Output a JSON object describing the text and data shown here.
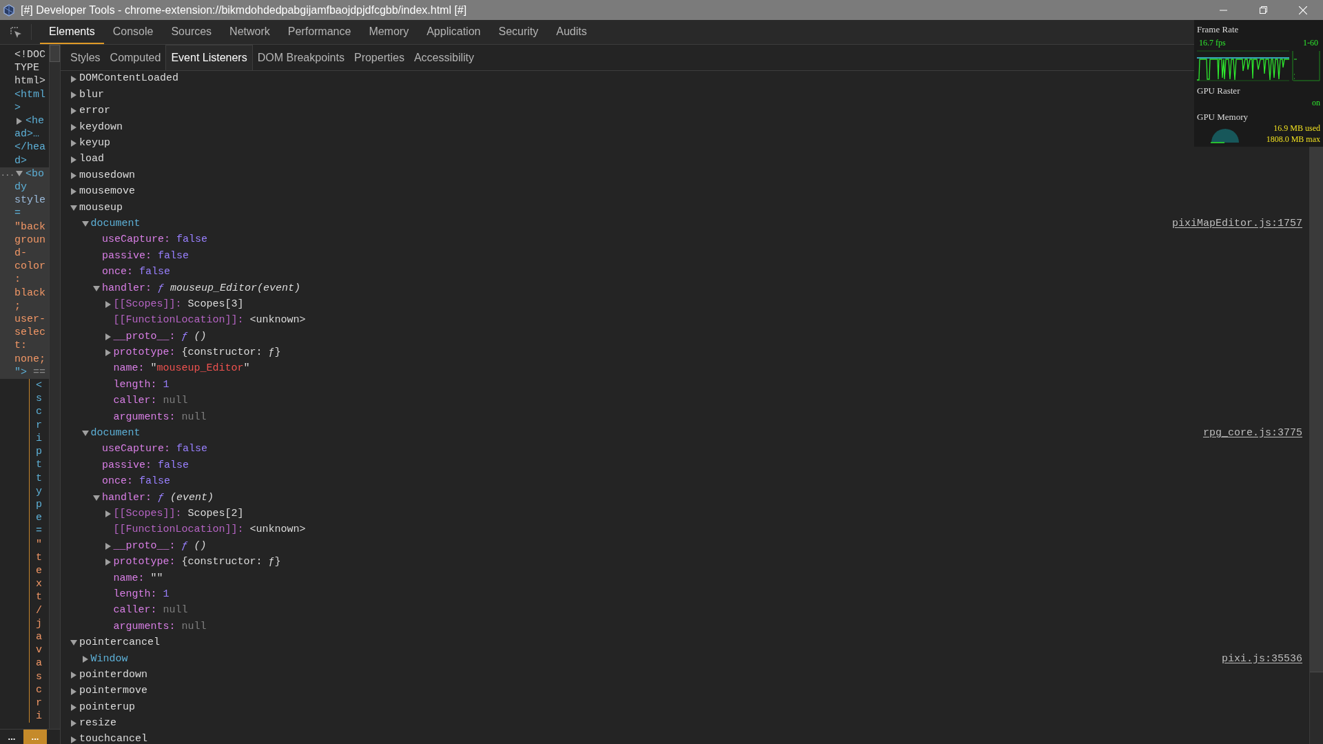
{
  "window": {
    "title": "[#] Developer Tools - chrome-extension://bikmdohdedpabgijamfbaojdpjdfcgbb/index.html [#]"
  },
  "tabs": [
    {
      "label": "Elements",
      "selected": true
    },
    {
      "label": "Console",
      "selected": false
    },
    {
      "label": "Sources",
      "selected": false
    },
    {
      "label": "Network",
      "selected": false
    },
    {
      "label": "Performance",
      "selected": false
    },
    {
      "label": "Memory",
      "selected": false
    },
    {
      "label": "Application",
      "selected": false
    },
    {
      "label": "Security",
      "selected": false
    },
    {
      "label": "Audits",
      "selected": false
    }
  ],
  "dom_panel": {
    "nodes": [
      {
        "kind": "block",
        "lines": [
          {
            "text": "<!DOC",
            "kind": "text"
          },
          {
            "text": "TYPE",
            "kind": "text"
          },
          {
            "text": "html>",
            "kind": "text"
          }
        ]
      },
      {
        "kind": "block",
        "lines": [
          {
            "text": "<html",
            "kind": "tag"
          },
          {
            "text": ">",
            "kind": "tag"
          }
        ]
      },
      {
        "kind": "block",
        "expanded": false,
        "selected": false,
        "lines": [
          {
            "text": "<he",
            "kind": "tag"
          },
          {
            "text": "ad>…",
            "kind": "tag"
          },
          {
            "text": "</hea",
            "kind": "tag"
          },
          {
            "text": "d>",
            "kind": "tag"
          }
        ]
      },
      {
        "kind": "block",
        "expanded": true,
        "selected": true,
        "more": "...",
        "marker": "==",
        "lines": [
          {
            "text": "<bo",
            "kind": "tag"
          },
          {
            "text": "dy",
            "kind": "tag"
          },
          {
            "text": "style",
            "kind": "attr"
          },
          {
            "text": "=",
            "kind": "tag"
          },
          {
            "text": "\"back",
            "kind": "value"
          },
          {
            "text": "groun",
            "kind": "value"
          },
          {
            "text": "d-",
            "kind": "value"
          },
          {
            "text": "color",
            "kind": "value"
          },
          {
            "text": ":",
            "kind": "value"
          },
          {
            "text": "black",
            "kind": "value"
          },
          {
            "text": ";",
            "kind": "value"
          },
          {
            "text": "user-",
            "kind": "value"
          },
          {
            "text": "selec",
            "kind": "value"
          },
          {
            "text": "t:",
            "kind": "value"
          },
          {
            "text": "none;",
            "kind": "value"
          },
          {
            "text": "\">",
            "kind": "tag"
          }
        ]
      },
      {
        "kind": "vertical",
        "tag": "<script type=",
        "value": "\"text/javascri"
      }
    ],
    "breadcrumbs": [
      {
        "label": "...",
        "selected": false
      },
      {
        "label": "...",
        "selected": true
      }
    ]
  },
  "subtabs": [
    {
      "label": "Styles",
      "selected": false
    },
    {
      "label": "Computed",
      "selected": false
    },
    {
      "label": "Event Listeners",
      "selected": true
    },
    {
      "label": "DOM Breakpoints",
      "selected": false
    },
    {
      "label": "Properties",
      "selected": false
    },
    {
      "label": "Accessibility",
      "selected": false
    }
  ],
  "events": [
    {
      "key": "DOMContentLoaded",
      "kind": "event",
      "expanded": false
    },
    {
      "key": "blur",
      "kind": "event",
      "expanded": false
    },
    {
      "key": "error",
      "kind": "event",
      "expanded": false
    },
    {
      "key": "keydown",
      "kind": "event",
      "expanded": false
    },
    {
      "key": "keyup",
      "kind": "event",
      "expanded": false
    },
    {
      "key": "load",
      "kind": "event",
      "expanded": false
    },
    {
      "key": "mousedown",
      "kind": "event",
      "expanded": false
    },
    {
      "key": "mousemove",
      "kind": "event",
      "expanded": false
    },
    {
      "key": "mouseup",
      "kind": "event",
      "expanded": true,
      "children": [
        {
          "key": "document",
          "kind": "target",
          "expanded": true,
          "source": "pixiMapEditor.js:1757",
          "children": [
            {
              "key": "useCapture:",
              "kind": "property",
              "value": {
                "kind": "keyword",
                "text": "false"
              }
            },
            {
              "key": "passive:",
              "kind": "property",
              "value": {
                "kind": "keyword",
                "text": "false"
              }
            },
            {
              "key": "once:",
              "kind": "property",
              "value": {
                "kind": "keyword",
                "text": "false"
              }
            },
            {
              "key": "handler:",
              "kind": "property",
              "value": {
                "kind": "function",
                "text": "ƒ mouseup_Editor(event)"
              },
              "expanded": true,
              "children": [
                {
                  "key": "[[Scopes]]:",
                  "kind": "internal",
                  "value": {
                    "kind": "object",
                    "text": "Scopes[3]"
                  },
                  "expanded": false
                },
                {
                  "key": "[[FunctionLocation]]:",
                  "kind": "internal",
                  "value": {
                    "kind": "object",
                    "text": "<unknown>"
                  }
                },
                {
                  "key": "__proto__:",
                  "kind": "property",
                  "value": {
                    "kind": "function",
                    "text": "ƒ ()"
                  },
                  "expanded": false
                },
                {
                  "key": "prototype:",
                  "kind": "property",
                  "value": {
                    "kind": "object",
                    "text": "{constructor: ƒ}"
                  },
                  "expanded": false
                },
                {
                  "key": "name:",
                  "kind": "property",
                  "value": {
                    "kind": "string",
                    "text": "\"mouseup_Editor\""
                  }
                },
                {
                  "key": "length:",
                  "kind": "property",
                  "value": {
                    "kind": "number",
                    "text": "1"
                  }
                },
                {
                  "key": "caller:",
                  "kind": "property",
                  "value": {
                    "kind": "null",
                    "text": "null"
                  }
                },
                {
                  "key": "arguments:",
                  "kind": "property",
                  "value": {
                    "kind": "null",
                    "text": "null"
                  }
                }
              ]
            }
          ]
        },
        {
          "key": "document",
          "kind": "target",
          "expanded": true,
          "source": "rpg_core.js:3775",
          "children": [
            {
              "key": "useCapture:",
              "kind": "property",
              "value": {
                "kind": "keyword",
                "text": "false"
              }
            },
            {
              "key": "passive:",
              "kind": "property",
              "value": {
                "kind": "keyword",
                "text": "false"
              }
            },
            {
              "key": "once:",
              "kind": "property",
              "value": {
                "kind": "keyword",
                "text": "false"
              }
            },
            {
              "key": "handler:",
              "kind": "property",
              "value": {
                "kind": "function",
                "text": "ƒ (event)"
              },
              "expanded": true,
              "children": [
                {
                  "key": "[[Scopes]]:",
                  "kind": "internal",
                  "value": {
                    "kind": "object",
                    "text": "Scopes[2]"
                  },
                  "expanded": false
                },
                {
                  "key": "[[FunctionLocation]]:",
                  "kind": "internal",
                  "value": {
                    "kind": "object",
                    "text": "<unknown>"
                  }
                },
                {
                  "key": "__proto__:",
                  "kind": "property",
                  "value": {
                    "kind": "function",
                    "text": "ƒ ()"
                  },
                  "expanded": false
                },
                {
                  "key": "prototype:",
                  "kind": "property",
                  "value": {
                    "kind": "object",
                    "text": "{constructor: ƒ}"
                  },
                  "expanded": false
                },
                {
                  "key": "name:",
                  "kind": "property",
                  "value": {
                    "kind": "string",
                    "text": "\"\""
                  }
                },
                {
                  "key": "length:",
                  "kind": "property",
                  "value": {
                    "kind": "number",
                    "text": "1"
                  }
                },
                {
                  "key": "caller:",
                  "kind": "property",
                  "value": {
                    "kind": "null",
                    "text": "null"
                  }
                },
                {
                  "key": "arguments:",
                  "kind": "property",
                  "value": {
                    "kind": "null",
                    "text": "null"
                  }
                }
              ]
            }
          ]
        }
      ]
    },
    {
      "key": "pointercancel",
      "kind": "event",
      "expanded": true,
      "children": [
        {
          "key": "Window",
          "kind": "target",
          "expanded": false,
          "source": "pixi.js:35536"
        }
      ]
    },
    {
      "key": "pointerdown",
      "kind": "event",
      "expanded": false
    },
    {
      "key": "pointermove",
      "kind": "event",
      "expanded": false
    },
    {
      "key": "pointerup",
      "kind": "event",
      "expanded": false
    },
    {
      "key": "resize",
      "kind": "event",
      "expanded": false
    },
    {
      "key": "touchcancel",
      "kind": "event",
      "expanded": false
    }
  ],
  "fps_meter": {
    "frame_rate": {
      "title": "Frame Rate",
      "reading": "16.7 fps",
      "range": "1-60"
    },
    "gpu_raster": {
      "title": "GPU Raster",
      "status": "on"
    },
    "gpu_memory": {
      "title": "GPU Memory",
      "used": "16.9 MB used",
      "max": "1808.0 MB max"
    }
  }
}
